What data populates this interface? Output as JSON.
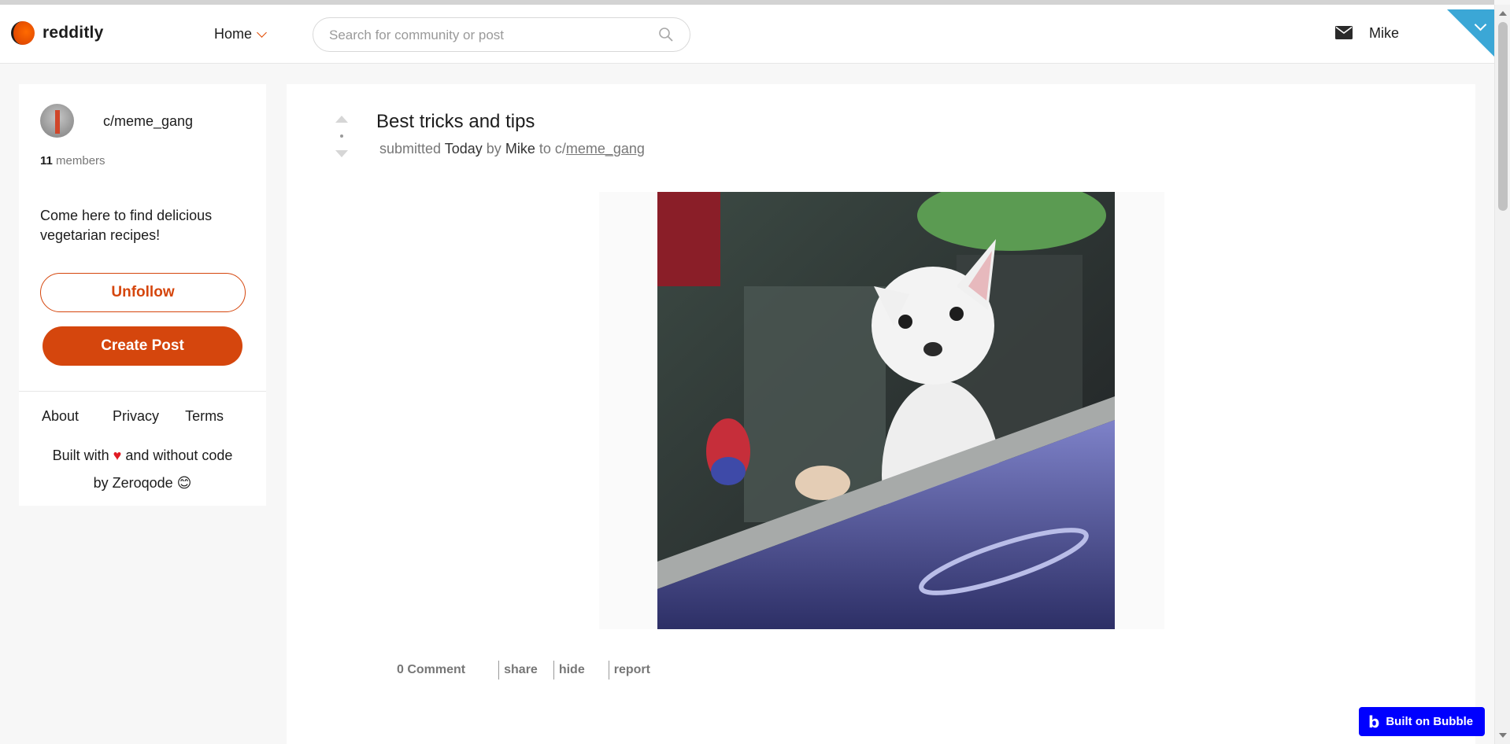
{
  "app": {
    "name": "redditly",
    "brand_color": "#d5460d",
    "accent_color": "#3ba7d6"
  },
  "header": {
    "nav_label": "Home",
    "search": {
      "placeholder": "Search for community or post",
      "value": ""
    },
    "user_name": "Mike",
    "icons": [
      "chevron-down-icon",
      "search-icon",
      "mail-icon"
    ]
  },
  "sidebar": {
    "community_name": "c/meme_gang",
    "members_count": "11",
    "members_label": "members",
    "description": "Come here to find delicious vegetarian recipes!",
    "unfollow_label": "Unfollow",
    "create_post_label": "Create Post",
    "footer_links": [
      "About",
      "Privacy",
      "Terms"
    ],
    "built_line1_a": "Built with",
    "heart": "♥",
    "built_line1_b": "and without code",
    "built_line2": "by Zeroqode",
    "smile": "😊"
  },
  "post": {
    "title": "Best tricks and tips",
    "meta": {
      "submitted": "submitted",
      "when": "Today",
      "by": "by",
      "author": "Mike",
      "to": "to c/",
      "community": "meme_gang"
    },
    "actions": [
      "0 Comment",
      "share",
      "hide",
      "report"
    ],
    "image": "photo of a small white chihuahua in a car window"
  },
  "badge": {
    "label": "Built on Bubble",
    "mark": "b"
  }
}
